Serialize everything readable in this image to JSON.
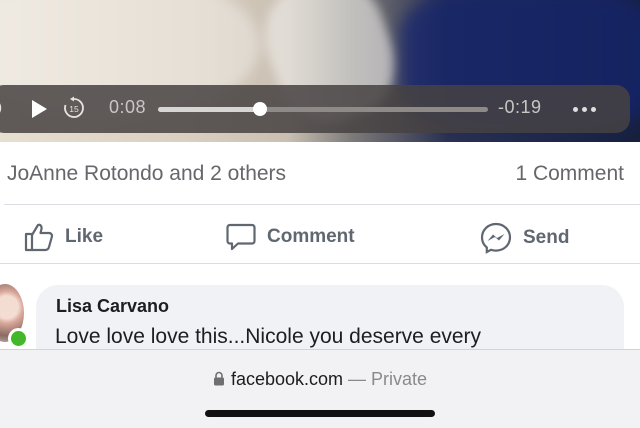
{
  "video": {
    "current_time": "0:08",
    "remaining_time": "-0:19",
    "skip_seconds": "15",
    "progress": 0.31
  },
  "reactions": {
    "names": "JoAnne Rotondo and 2 others",
    "comment_count": "1 Comment"
  },
  "actions": {
    "like": "Like",
    "comment": "Comment",
    "send": "Send"
  },
  "comment": {
    "author": "Lisa Carvano",
    "text": "Love love love this...Nicole you deserve every"
  },
  "browser": {
    "domain": "facebook.com",
    "privacy": " — Private"
  },
  "colors": {
    "online": "#42b72a",
    "action_text": "#606770",
    "secondary_text": "#66676b"
  },
  "icons": [
    "play-icon",
    "replay-15-icon",
    "more-icon",
    "like-icon",
    "comment-icon",
    "messenger-icon",
    "lock-icon"
  ]
}
